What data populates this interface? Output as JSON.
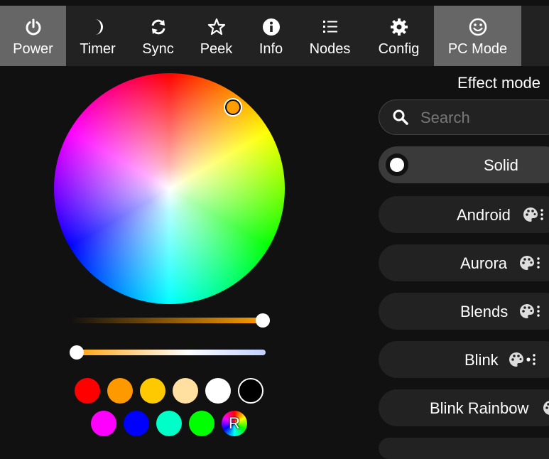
{
  "nav": {
    "tabs": [
      {
        "label": "Power",
        "icon": "power-icon",
        "active": true
      },
      {
        "label": "Timer",
        "icon": "moon-icon"
      },
      {
        "label": "Sync",
        "icon": "sync-icon"
      },
      {
        "label": "Peek",
        "icon": "star-icon"
      },
      {
        "label": "Info",
        "icon": "info-icon"
      },
      {
        "label": "Nodes",
        "icon": "list-icon"
      },
      {
        "label": "Config",
        "icon": "gear-icon"
      },
      {
        "label": "PC Mode",
        "icon": "smiley-icon",
        "active": true
      }
    ]
  },
  "colors": {
    "background": "#111111",
    "nav_background": "#222222",
    "active_tab": "#666666",
    "accent": "#ff9d00",
    "button": "#222222"
  },
  "color_picker": {
    "selected_color": "#ff9d00",
    "brightness_level": 0.97,
    "white_balance_level": 0.0
  },
  "swatches": {
    "row1": [
      "#ff0000",
      "#ff9900",
      "#ffc900",
      "#ffe0a0",
      "#ffffff",
      "#000000"
    ],
    "row2": [
      "#ff00ff",
      "#0000ff",
      "#00ffc8",
      "#00ff00"
    ],
    "random_label": "R"
  },
  "effects": {
    "title": "Effect mode",
    "search_placeholder": "Search",
    "items": [
      {
        "name": "Solid",
        "selected": true
      },
      {
        "name": "Android",
        "icons": [
          "palette-icon",
          "more-icon"
        ]
      },
      {
        "name": "Aurora",
        "icons": [
          "palette-icon",
          "more-icon"
        ]
      },
      {
        "name": "Blends",
        "icons": [
          "palette-icon",
          "more-icon"
        ]
      },
      {
        "name": "Blink",
        "icons": [
          "palette-icon",
          "dot-more-icon"
        ]
      },
      {
        "name": "Blink Rainbow",
        "icons": [
          "palette-icon"
        ]
      }
    ]
  }
}
